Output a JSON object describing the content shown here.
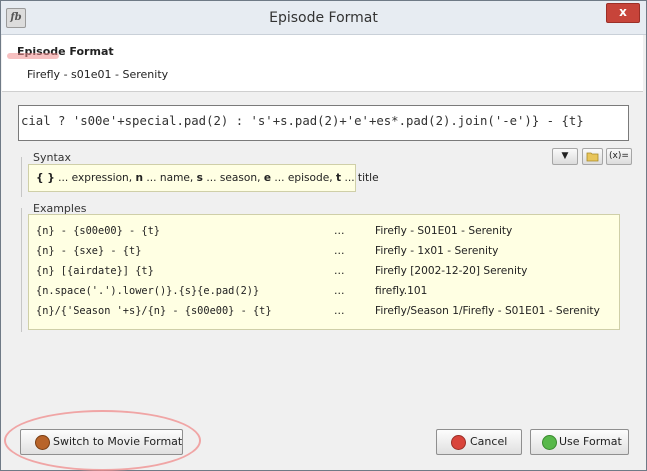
{
  "window": {
    "app_icon": "fb",
    "title": "Episode Format",
    "close_glyph": "x"
  },
  "header": {
    "title": "Episode Format",
    "subtitle": "Firefly - s01e01 - Serenity"
  },
  "expression": {
    "value": "cial ? 's00e'+special.pad(2) : 's'+s.pad(2)+'e'+es*.pad(2).join('-e')} - {t}"
  },
  "syntax": {
    "label": "Syntax",
    "parts": {
      "braces": "{ }",
      "t1": " ... expression, ",
      "n": "n",
      "t2": " ... name, ",
      "s": "s",
      "t3": " ... season, ",
      "e": "e",
      "t4": " ... episode, ",
      "t": "t",
      "t5": " ... title"
    },
    "tools": {
      "dropdown": "▼",
      "folder": "folder-icon",
      "fx": "(x)="
    }
  },
  "examples": {
    "label": "Examples",
    "rows": [
      {
        "expr": "{n} - {s00e00} - {t}",
        "sep": "...",
        "result": "Firefly - S01E01 - Serenity"
      },
      {
        "expr": "{n} - {sxe} - {t}",
        "sep": "...",
        "result": "Firefly - 1x01 - Serenity"
      },
      {
        "expr": "{n} [{airdate}] {t}",
        "sep": "...",
        "result": "Firefly [2002-12-20] Serenity"
      },
      {
        "expr": "{n.space('.').lower()}.{s}{e.pad(2)}",
        "sep": "...",
        "result": "firefly.101"
      },
      {
        "expr": "{n}/{'Season '+s}/{n} - {s00e00} - {t}",
        "sep": "...",
        "result": "Firefly/Season 1/Firefly - S01E01 - Serenity"
      }
    ]
  },
  "buttons": {
    "switch": "Switch to Movie Format",
    "cancel": "Cancel",
    "use": "Use Format"
  },
  "colors": {
    "cancel_icon": "#d9443b",
    "use_icon": "#58b84a",
    "switch_icon": "#b8642a"
  }
}
